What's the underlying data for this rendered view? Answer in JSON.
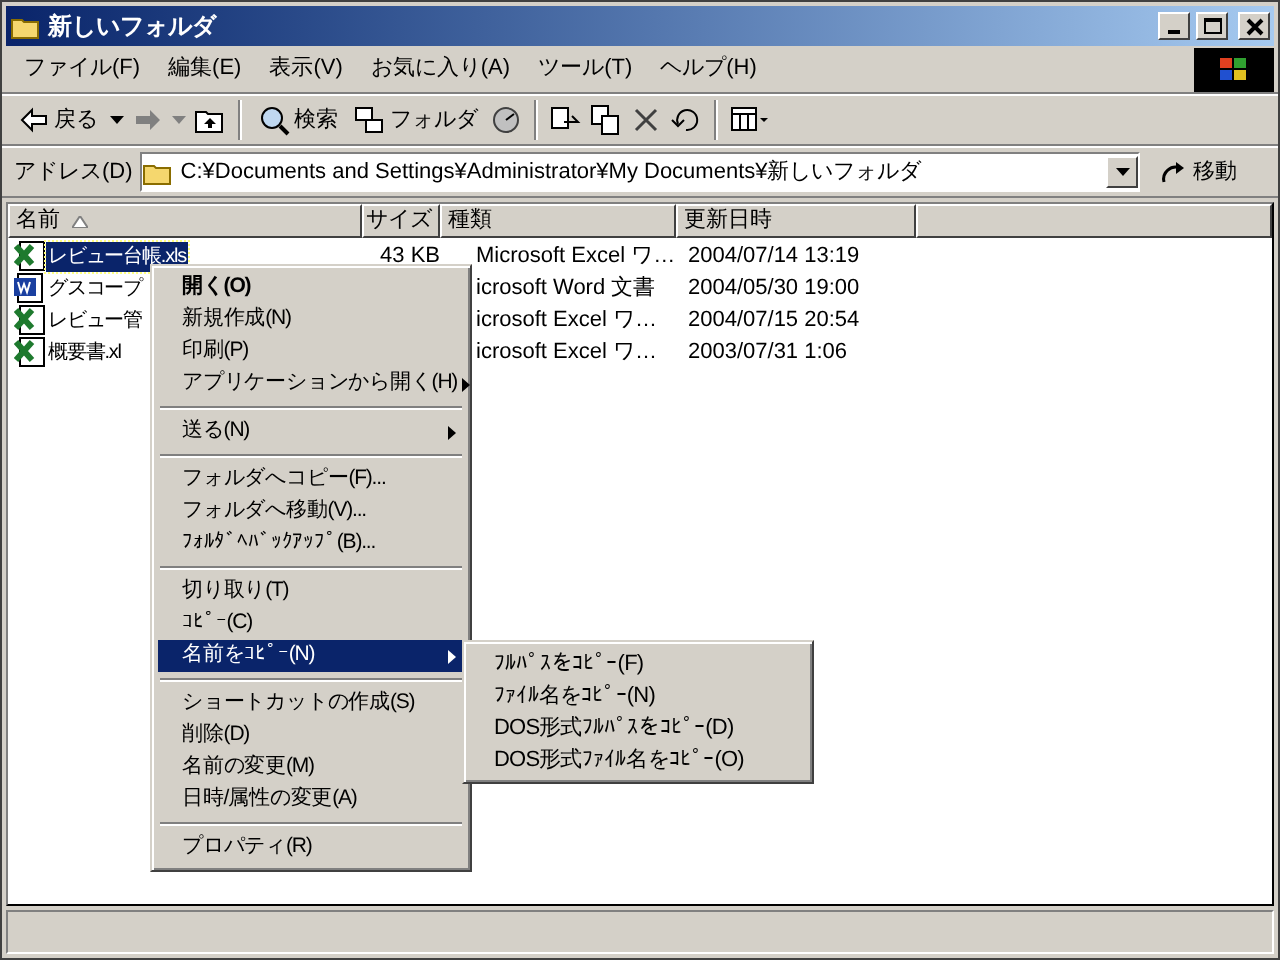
{
  "window": {
    "title": "新しいフォルダ"
  },
  "menu_bar": [
    "ファイル(F)",
    "編集(E)",
    "表示(V)",
    "お気に入り(A)",
    "ツール(T)",
    "ヘルプ(H)"
  ],
  "toolbar": [
    {
      "kind": "back",
      "label": "戻る"
    },
    {
      "kind": "forward"
    },
    {
      "kind": "up"
    },
    {
      "kind": "separator"
    },
    {
      "kind": "search",
      "label": "検索"
    },
    {
      "kind": "folders",
      "label": "フォルダ"
    },
    {
      "kind": "history"
    },
    {
      "kind": "separator"
    },
    {
      "kind": "move"
    },
    {
      "kind": "copy"
    },
    {
      "kind": "delete"
    },
    {
      "kind": "undo"
    },
    {
      "kind": "separator"
    },
    {
      "kind": "views"
    }
  ],
  "address": {
    "label": "アドレス(D)",
    "value": "C:¥Documents and Settings¥Administrator¥My Documents¥新しいフォルダ",
    "go": "移動"
  },
  "columns": [
    "名前",
    "サイズ",
    "種類",
    "更新日時"
  ],
  "rows": [
    {
      "kind": "excel",
      "name": "レビュー台帳.xls",
      "size": "43 KB",
      "type": "Microsoft Excel ワ…",
      "modified": "2004/07/14 13:19",
      "selected": true
    },
    {
      "kind": "word",
      "name": "グスコープ",
      "size": "",
      "type": "icrosoft Word 文書",
      "modified": "2004/05/30 19:00",
      "selected": false
    },
    {
      "kind": "excel",
      "name": "レビュー管",
      "size": "",
      "type": "icrosoft Excel ワ…",
      "modified": "2004/07/15 20:54",
      "selected": false
    },
    {
      "kind": "excel",
      "name": "概要書.xl",
      "size": "",
      "type": "icrosoft Excel ワ…",
      "modified": "2003/07/31 1:06",
      "selected": false
    }
  ],
  "context_menu": [
    {
      "kind": "item",
      "label": "開く(O)",
      "default": true,
      "submenu": false,
      "selected": false
    },
    {
      "kind": "item",
      "label": "新規作成(N)",
      "default": false,
      "submenu": false,
      "selected": false
    },
    {
      "kind": "item",
      "label": "印刷(P)",
      "default": false,
      "submenu": false,
      "selected": false
    },
    {
      "kind": "item",
      "label": "アプリケーションから開く(H)",
      "default": false,
      "submenu": true,
      "selected": false
    },
    {
      "kind": "separator"
    },
    {
      "kind": "item",
      "label": "送る(N)",
      "default": false,
      "submenu": true,
      "selected": false
    },
    {
      "kind": "separator"
    },
    {
      "kind": "item",
      "label": "フォルダへコピー(F)...",
      "default": false,
      "submenu": false,
      "selected": false
    },
    {
      "kind": "item",
      "label": "フォルダへ移動(V)...",
      "default": false,
      "submenu": false,
      "selected": false
    },
    {
      "kind": "item",
      "label": "ﾌｫﾙﾀﾞﾍﾊﾞｯｸｱｯﾌﾟ(B)...",
      "default": false,
      "submenu": false,
      "selected": false
    },
    {
      "kind": "separator"
    },
    {
      "kind": "item",
      "label": "切り取り(T)",
      "default": false,
      "submenu": false,
      "selected": false
    },
    {
      "kind": "item",
      "label": "ｺﾋﾟｰ(C)",
      "default": false,
      "submenu": false,
      "selected": false
    },
    {
      "kind": "item",
      "label": "名前をｺﾋﾟｰ(N)",
      "default": false,
      "submenu": true,
      "selected": true
    },
    {
      "kind": "separator"
    },
    {
      "kind": "item",
      "label": "ショートカットの作成(S)",
      "default": false,
      "submenu": false,
      "selected": false
    },
    {
      "kind": "item",
      "label": "削除(D)",
      "default": false,
      "submenu": false,
      "selected": false
    },
    {
      "kind": "item",
      "label": "名前の変更(M)",
      "default": false,
      "submenu": false,
      "selected": false
    },
    {
      "kind": "item",
      "label": "日時/属性の変更(A)",
      "default": false,
      "submenu": false,
      "selected": false
    },
    {
      "kind": "separator"
    },
    {
      "kind": "item",
      "label": "プロパティ(R)",
      "default": false,
      "submenu": false,
      "selected": false
    }
  ],
  "submenu": [
    "ﾌﾙﾊﾟｽをｺﾋﾟｰ(F)",
    "ﾌｧｲﾙ名をｺﾋﾟｰ(N)",
    "DOS形式ﾌﾙﾊﾟｽをｺﾋﾟｰ(D)",
    "DOS形式ﾌｧｲﾙ名をｺﾋﾟｰ(O)"
  ]
}
